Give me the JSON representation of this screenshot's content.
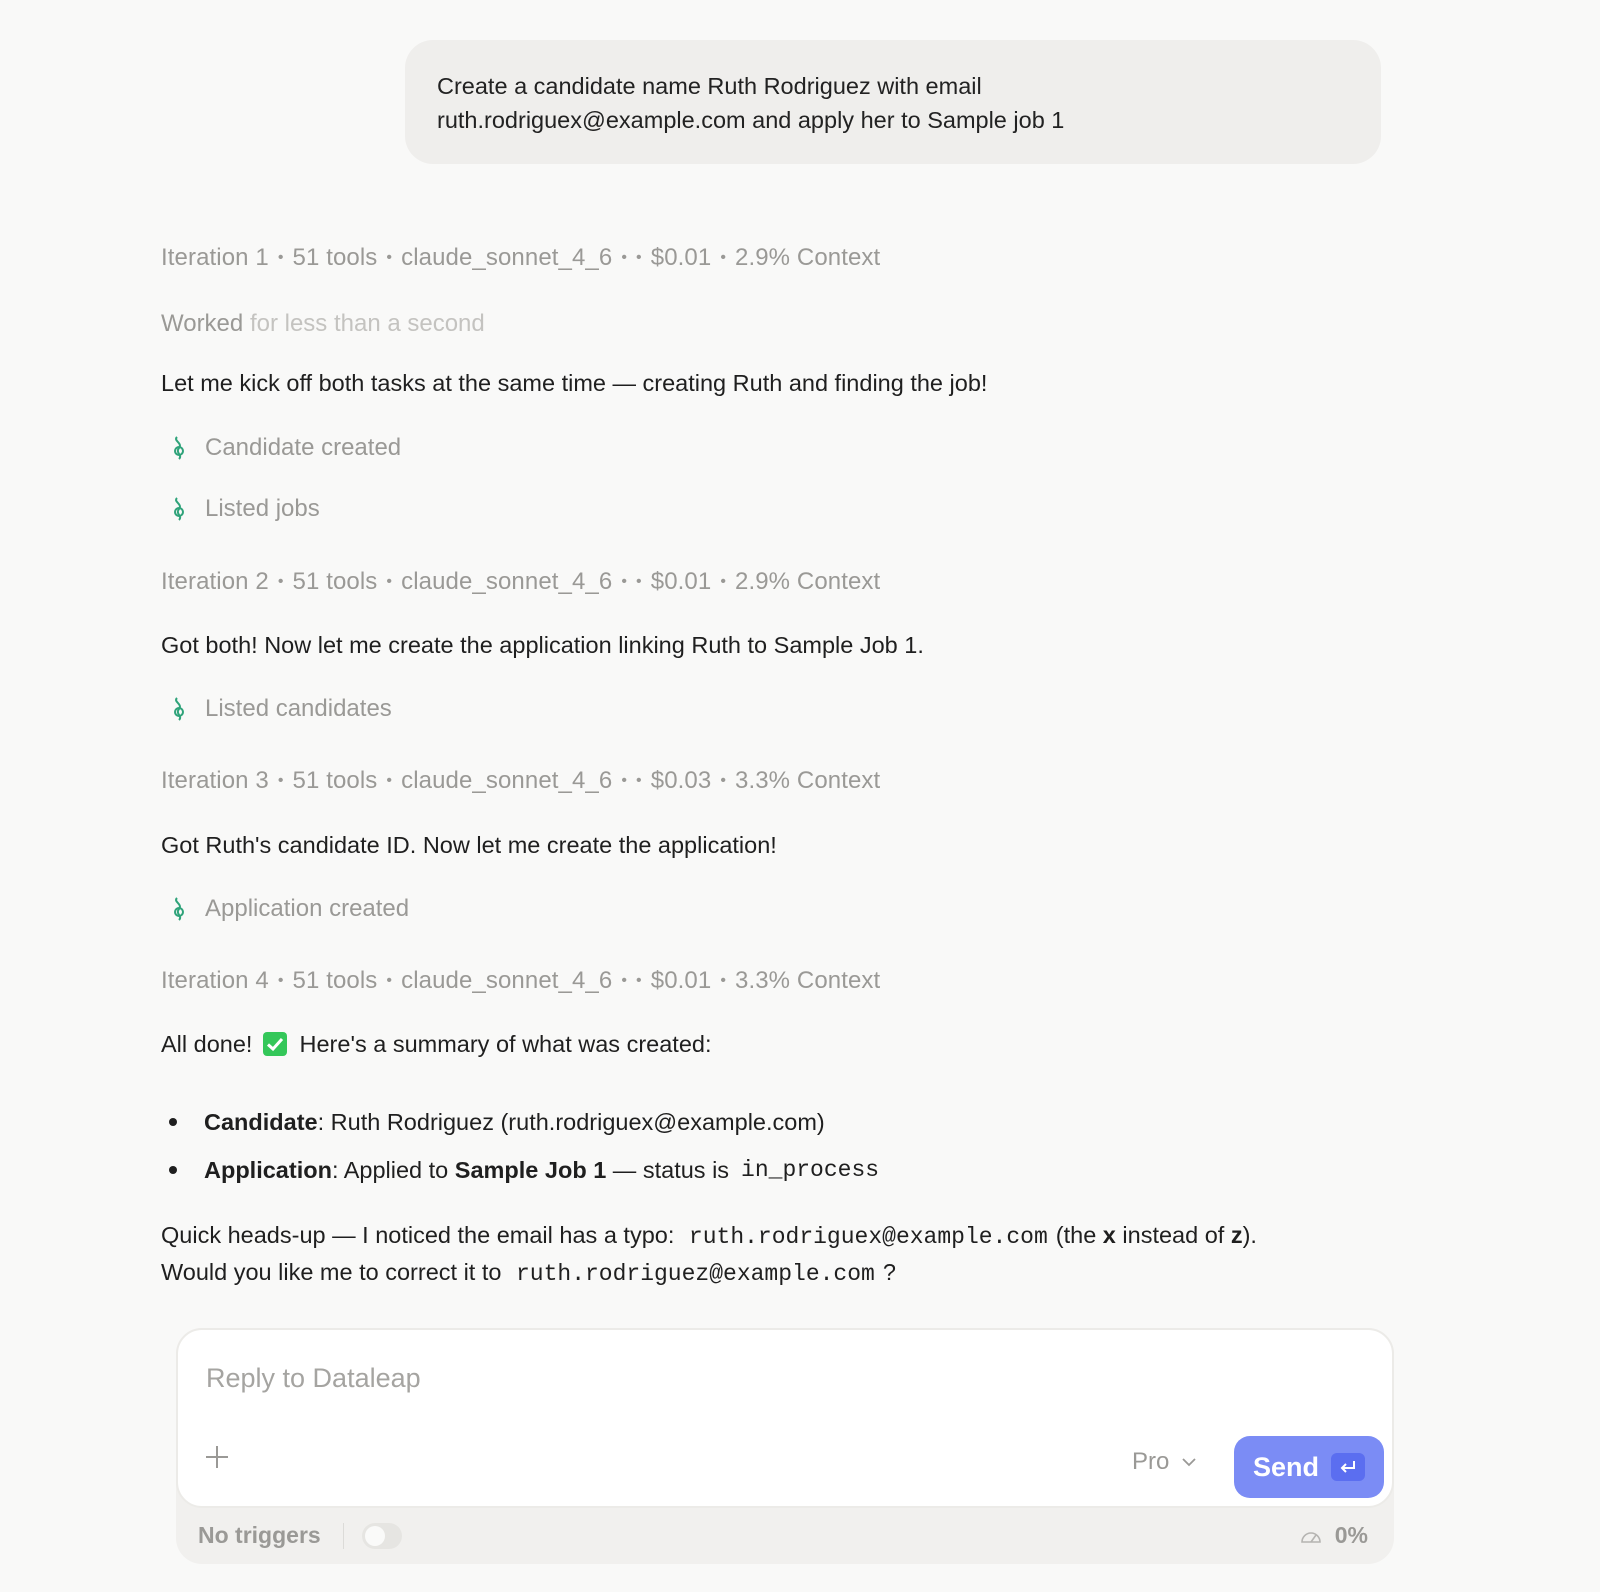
{
  "user_message": {
    "line1": "Create a candidate name Ruth Rodriguez with email",
    "line2": "ruth.rodriguex@example.com and apply her to Sample job 1"
  },
  "iterations": [
    {
      "label": "Iteration 1",
      "tools": "51 tools",
      "model": "claude_sonnet_4_6",
      "cost": "$0.01",
      "context": "2.9% Context"
    },
    {
      "label": "Iteration 2",
      "tools": "51 tools",
      "model": "claude_sonnet_4_6",
      "cost": "$0.01",
      "context": "2.9% Context"
    },
    {
      "label": "Iteration 3",
      "tools": "51 tools",
      "model": "claude_sonnet_4_6",
      "cost": "$0.03",
      "context": "3.3% Context"
    },
    {
      "label": "Iteration 4",
      "tools": "51 tools",
      "model": "claude_sonnet_4_6",
      "cost": "$0.01",
      "context": "3.3% Context"
    }
  ],
  "worked": {
    "prefix": "Worked",
    "suffix": "for less than a second"
  },
  "messages": {
    "m1": "Let me kick off both tasks at the same time — creating Ruth and finding the job!",
    "m2": "Got both! Now let me create the application linking Ruth to Sample Job 1.",
    "m3": "Got Ruth's candidate ID. Now let me create the application!",
    "m4_prefix": "All done!",
    "m4_suffix": "Here's a summary of what was created:"
  },
  "tool_calls": {
    "t1": "Candidate created",
    "t2": "Listed jobs",
    "t3": "Listed candidates",
    "t4": "Application created"
  },
  "summary": {
    "b1_label": "Candidate",
    "b1_text": ": Ruth Rodriguez (ruth.rodriguex@example.com)",
    "b2_label": "Application",
    "b2_text1": ": Applied to ",
    "b2_job": "Sample Job 1",
    "b2_text2": " — status is",
    "b2_status": "in_process"
  },
  "headsup": {
    "t1": "Quick heads-up — I noticed the email has a typo:",
    "email_wrong": "ruth.rodriguex@example.com",
    "t2": "(the ",
    "x": "x",
    "t3": " instead of ",
    "z": "z",
    "t4": ").",
    "t5": "Would you like me to correct it to",
    "email_right": "ruth.rodriguez@example.com",
    "t6": "?"
  },
  "composer": {
    "placeholder": "Reply to Dataleap",
    "model": "Pro",
    "send_label": "Send",
    "triggers": "No triggers",
    "usage": "0%"
  },
  "colors": {
    "accent": "#7b8cf5",
    "tool_icon": "#2fa37a",
    "check": "#34c759"
  },
  "icons": {
    "tool": "tool-icon",
    "plus": "plus-icon",
    "chevron": "chevron-down-icon",
    "enter": "enter-key-icon",
    "gauge": "gauge-icon",
    "check": "check-mark-icon"
  }
}
